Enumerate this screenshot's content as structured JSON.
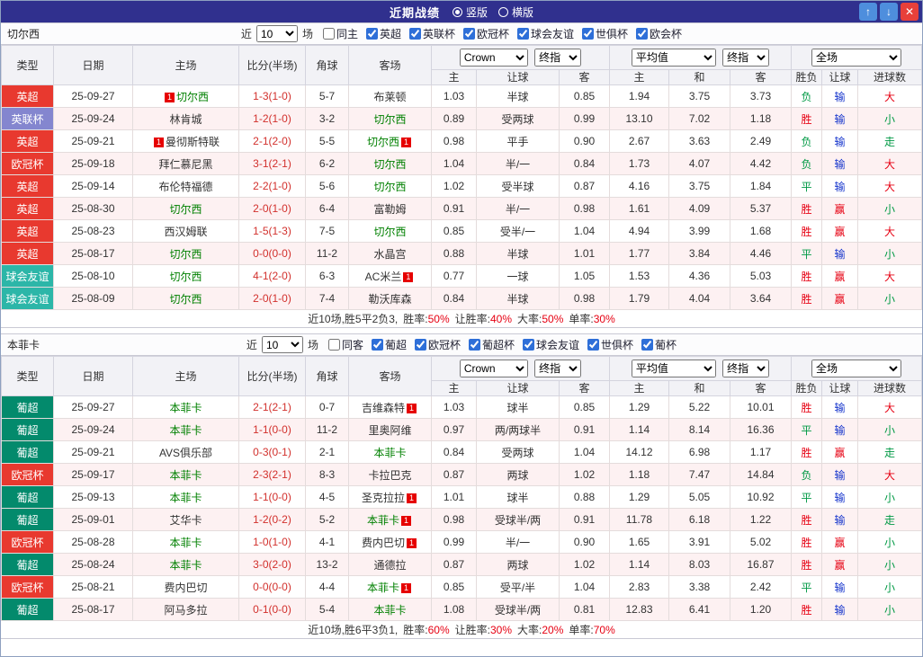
{
  "topbar": {
    "title": "近期战绩",
    "layout_options": [
      {
        "label": "竖版",
        "selected": true
      },
      {
        "label": "横版",
        "selected": false
      }
    ],
    "buttons": {
      "up": "↑",
      "down": "↓",
      "close": "✕"
    }
  },
  "badge_text": "1",
  "type_colors": {
    "英超": "#e8392f",
    "英联杯": "#8486cf",
    "欧冠杯": "#e8392f",
    "球会友谊": "#2cb6a8",
    "葡超": "#038a6c"
  },
  "result_colors": {
    "red": "#e60012",
    "green": "#009944",
    "blue": "#1534cc"
  },
  "columns": {
    "left": [
      "类型",
      "日期",
      "主场",
      "比分(半场)",
      "角球",
      "客场"
    ],
    "asian": [
      "主",
      "让球",
      "客"
    ],
    "euro": [
      "主",
      "和",
      "客"
    ],
    "result": [
      "胜负",
      "让球",
      "进球数"
    ]
  },
  "sections": [
    {
      "team": "切尔西",
      "filter": {
        "near_label": "近",
        "count": "10",
        "games_label": "场",
        "checkboxes": [
          {
            "label": "同主",
            "checked": false
          },
          {
            "label": "英超",
            "checked": true
          },
          {
            "label": "英联杯",
            "checked": true
          },
          {
            "label": "欧冠杯",
            "checked": true
          },
          {
            "label": "球会友谊",
            "checked": true
          },
          {
            "label": "世俱杯",
            "checked": true
          },
          {
            "label": "欧会杯",
            "checked": true
          }
        ]
      },
      "selects": {
        "odds_source": "Crown",
        "odds_time": "终指",
        "euro_source": "平均值",
        "euro_time": "终指",
        "scope": "全场"
      },
      "rows": [
        {
          "type": "英超",
          "date": "25-09-27",
          "home": {
            "name": "切尔西",
            "focus": true,
            "badge": "before"
          },
          "score": "1-3(1-0)",
          "corner": "5-7",
          "away": {
            "name": "布莱顿"
          },
          "asian": [
            "1.03",
            "半球",
            "0.85"
          ],
          "euro": [
            "1.94",
            "3.75",
            "3.73"
          ],
          "results": [
            [
              "负",
              "green"
            ],
            [
              "输",
              "blue"
            ],
            [
              "大",
              "red"
            ]
          ]
        },
        {
          "type": "英联杯",
          "date": "25-09-24",
          "home": {
            "name": "林肯城"
          },
          "score": "1-2(1-0)",
          "corner": "3-2",
          "away": {
            "name": "切尔西",
            "focus": true
          },
          "asian": [
            "0.89",
            "受两球",
            "0.99"
          ],
          "euro": [
            "13.10",
            "7.02",
            "1.18"
          ],
          "results": [
            [
              "胜",
              "red"
            ],
            [
              "输",
              "blue"
            ],
            [
              "小",
              "green"
            ]
          ]
        },
        {
          "type": "英超",
          "date": "25-09-21",
          "home": {
            "name": "曼彻斯特联",
            "badge": "before"
          },
          "score": "2-1(2-0)",
          "corner": "5-5",
          "away": {
            "name": "切尔西",
            "focus": true,
            "badge": "after"
          },
          "asian": [
            "0.98",
            "平手",
            "0.90"
          ],
          "euro": [
            "2.67",
            "3.63",
            "2.49"
          ],
          "results": [
            [
              "负",
              "green"
            ],
            [
              "输",
              "blue"
            ],
            [
              "走",
              "green"
            ]
          ]
        },
        {
          "type": "欧冠杯",
          "date": "25-09-18",
          "home": {
            "name": "拜仁慕尼黑"
          },
          "score": "3-1(2-1)",
          "corner": "6-2",
          "away": {
            "name": "切尔西",
            "focus": true
          },
          "asian": [
            "1.04",
            "半/一",
            "0.84"
          ],
          "euro": [
            "1.73",
            "4.07",
            "4.42"
          ],
          "results": [
            [
              "负",
              "green"
            ],
            [
              "输",
              "blue"
            ],
            [
              "大",
              "red"
            ]
          ]
        },
        {
          "type": "英超",
          "date": "25-09-14",
          "home": {
            "name": "布伦特福德"
          },
          "score": "2-2(1-0)",
          "corner": "5-6",
          "away": {
            "name": "切尔西",
            "focus": true
          },
          "asian": [
            "1.02",
            "受半球",
            "0.87"
          ],
          "euro": [
            "4.16",
            "3.75",
            "1.84"
          ],
          "results": [
            [
              "平",
              "green"
            ],
            [
              "输",
              "blue"
            ],
            [
              "大",
              "red"
            ]
          ]
        },
        {
          "type": "英超",
          "date": "25-08-30",
          "home": {
            "name": "切尔西",
            "focus": true
          },
          "score": "2-0(1-0)",
          "corner": "6-4",
          "away": {
            "name": "富勒姆"
          },
          "asian": [
            "0.91",
            "半/一",
            "0.98"
          ],
          "euro": [
            "1.61",
            "4.09",
            "5.37"
          ],
          "results": [
            [
              "胜",
              "red"
            ],
            [
              "赢",
              "red"
            ],
            [
              "小",
              "green"
            ]
          ]
        },
        {
          "type": "英超",
          "date": "25-08-23",
          "home": {
            "name": "西汉姆联"
          },
          "score": "1-5(1-3)",
          "corner": "7-5",
          "away": {
            "name": "切尔西",
            "focus": true
          },
          "asian": [
            "0.85",
            "受半/一",
            "1.04"
          ],
          "euro": [
            "4.94",
            "3.99",
            "1.68"
          ],
          "results": [
            [
              "胜",
              "red"
            ],
            [
              "赢",
              "red"
            ],
            [
              "大",
              "red"
            ]
          ]
        },
        {
          "type": "英超",
          "date": "25-08-17",
          "home": {
            "name": "切尔西",
            "focus": true
          },
          "score": "0-0(0-0)",
          "corner": "11-2",
          "away": {
            "name": "水晶宫"
          },
          "asian": [
            "0.88",
            "半球",
            "1.01"
          ],
          "euro": [
            "1.77",
            "3.84",
            "4.46"
          ],
          "results": [
            [
              "平",
              "green"
            ],
            [
              "输",
              "blue"
            ],
            [
              "小",
              "green"
            ]
          ]
        },
        {
          "type": "球会友谊",
          "date": "25-08-10",
          "home": {
            "name": "切尔西",
            "focus": true
          },
          "score": "4-1(2-0)",
          "corner": "6-3",
          "away": {
            "name": "AC米兰",
            "badge": "after"
          },
          "asian": [
            "0.77",
            "一球",
            "1.05"
          ],
          "euro": [
            "1.53",
            "4.36",
            "5.03"
          ],
          "results": [
            [
              "胜",
              "red"
            ],
            [
              "赢",
              "red"
            ],
            [
              "大",
              "red"
            ]
          ]
        },
        {
          "type": "球会友谊",
          "date": "25-08-09",
          "home": {
            "name": "切尔西",
            "focus": true
          },
          "score": "2-0(1-0)",
          "corner": "7-4",
          "away": {
            "name": "勒沃库森"
          },
          "asian": [
            "0.84",
            "半球",
            "0.98"
          ],
          "euro": [
            "1.79",
            "4.04",
            "3.64"
          ],
          "results": [
            [
              "胜",
              "red"
            ],
            [
              "赢",
              "red"
            ],
            [
              "小",
              "green"
            ]
          ]
        }
      ],
      "summary": {
        "prefix": "近10场,胜5平2负3,",
        "stats": [
          [
            "胜率:",
            "50%"
          ],
          [
            "让胜率:",
            "40%"
          ],
          [
            "大率:",
            "50%"
          ],
          [
            "单率:",
            "30%"
          ]
        ]
      }
    },
    {
      "team": "本菲卡",
      "filter": {
        "near_label": "近",
        "count": "10",
        "games_label": "场",
        "checkboxes": [
          {
            "label": "同客",
            "checked": false
          },
          {
            "label": "葡超",
            "checked": true
          },
          {
            "label": "欧冠杯",
            "checked": true
          },
          {
            "label": "葡超杯",
            "checked": true
          },
          {
            "label": "球会友谊",
            "checked": true
          },
          {
            "label": "世俱杯",
            "checked": true
          },
          {
            "label": "葡杯",
            "checked": true
          }
        ]
      },
      "selects": {
        "odds_source": "Crown",
        "odds_time": "终指",
        "euro_source": "平均值",
        "euro_time": "终指",
        "scope": "全场"
      },
      "rows": [
        {
          "type": "葡超",
          "date": "25-09-27",
          "home": {
            "name": "本菲卡",
            "focus": true
          },
          "score": "2-1(2-1)",
          "corner": "0-7",
          "away": {
            "name": "吉维森特",
            "badge": "after"
          },
          "asian": [
            "1.03",
            "球半",
            "0.85"
          ],
          "euro": [
            "1.29",
            "5.22",
            "10.01"
          ],
          "results": [
            [
              "胜",
              "red"
            ],
            [
              "输",
              "blue"
            ],
            [
              "大",
              "red"
            ]
          ]
        },
        {
          "type": "葡超",
          "date": "25-09-24",
          "home": {
            "name": "本菲卡",
            "focus": true
          },
          "score": "1-1(0-0)",
          "corner": "11-2",
          "away": {
            "name": "里奥阿维"
          },
          "asian": [
            "0.97",
            "两/两球半",
            "0.91"
          ],
          "euro": [
            "1.14",
            "8.14",
            "16.36"
          ],
          "results": [
            [
              "平",
              "green"
            ],
            [
              "输",
              "blue"
            ],
            [
              "小",
              "green"
            ]
          ]
        },
        {
          "type": "葡超",
          "date": "25-09-21",
          "home": {
            "name": "AVS俱乐部"
          },
          "score": "0-3(0-1)",
          "corner": "2-1",
          "away": {
            "name": "本菲卡",
            "focus": true
          },
          "asian": [
            "0.84",
            "受两球",
            "1.04"
          ],
          "euro": [
            "14.12",
            "6.98",
            "1.17"
          ],
          "results": [
            [
              "胜",
              "red"
            ],
            [
              "赢",
              "red"
            ],
            [
              "走",
              "green"
            ]
          ]
        },
        {
          "type": "欧冠杯",
          "date": "25-09-17",
          "home": {
            "name": "本菲卡",
            "focus": true
          },
          "score": "2-3(2-1)",
          "corner": "8-3",
          "away": {
            "name": "卡拉巴克"
          },
          "asian": [
            "0.87",
            "两球",
            "1.02"
          ],
          "euro": [
            "1.18",
            "7.47",
            "14.84"
          ],
          "results": [
            [
              "负",
              "green"
            ],
            [
              "输",
              "blue"
            ],
            [
              "大",
              "red"
            ]
          ]
        },
        {
          "type": "葡超",
          "date": "25-09-13",
          "home": {
            "name": "本菲卡",
            "focus": true
          },
          "score": "1-1(0-0)",
          "corner": "4-5",
          "away": {
            "name": "圣克拉拉",
            "badge": "after"
          },
          "asian": [
            "1.01",
            "球半",
            "0.88"
          ],
          "euro": [
            "1.29",
            "5.05",
            "10.92"
          ],
          "results": [
            [
              "平",
              "green"
            ],
            [
              "输",
              "blue"
            ],
            [
              "小",
              "green"
            ]
          ]
        },
        {
          "type": "葡超",
          "date": "25-09-01",
          "home": {
            "name": "艾华卡"
          },
          "score": "1-2(0-2)",
          "corner": "5-2",
          "away": {
            "name": "本菲卡",
            "focus": true,
            "badge": "after"
          },
          "asian": [
            "0.98",
            "受球半/两",
            "0.91"
          ],
          "euro": [
            "11.78",
            "6.18",
            "1.22"
          ],
          "results": [
            [
              "胜",
              "red"
            ],
            [
              "输",
              "blue"
            ],
            [
              "走",
              "green"
            ]
          ]
        },
        {
          "type": "欧冠杯",
          "date": "25-08-28",
          "home": {
            "name": "本菲卡",
            "focus": true
          },
          "score": "1-0(1-0)",
          "corner": "4-1",
          "away": {
            "name": "费内巴切",
            "badge": "after"
          },
          "asian": [
            "0.99",
            "半/一",
            "0.90"
          ],
          "euro": [
            "1.65",
            "3.91",
            "5.02"
          ],
          "results": [
            [
              "胜",
              "red"
            ],
            [
              "赢",
              "red"
            ],
            [
              "小",
              "green"
            ]
          ]
        },
        {
          "type": "葡超",
          "date": "25-08-24",
          "home": {
            "name": "本菲卡",
            "focus": true
          },
          "score": "3-0(2-0)",
          "corner": "13-2",
          "away": {
            "name": "通德拉"
          },
          "asian": [
            "0.87",
            "两球",
            "1.02"
          ],
          "euro": [
            "1.14",
            "8.03",
            "16.87"
          ],
          "results": [
            [
              "胜",
              "red"
            ],
            [
              "赢",
              "red"
            ],
            [
              "小",
              "green"
            ]
          ]
        },
        {
          "type": "欧冠杯",
          "date": "25-08-21",
          "home": {
            "name": "费内巴切"
          },
          "score": "0-0(0-0)",
          "corner": "4-4",
          "away": {
            "name": "本菲卡",
            "focus": true,
            "badge": "after"
          },
          "asian": [
            "0.85",
            "受平/半",
            "1.04"
          ],
          "euro": [
            "2.83",
            "3.38",
            "2.42"
          ],
          "results": [
            [
              "平",
              "green"
            ],
            [
              "输",
              "blue"
            ],
            [
              "小",
              "green"
            ]
          ]
        },
        {
          "type": "葡超",
          "date": "25-08-17",
          "home": {
            "name": "阿马多拉"
          },
          "score": "0-1(0-0)",
          "corner": "5-4",
          "away": {
            "name": "本菲卡",
            "focus": true
          },
          "asian": [
            "1.08",
            "受球半/两",
            "0.81"
          ],
          "euro": [
            "12.83",
            "6.41",
            "1.20"
          ],
          "results": [
            [
              "胜",
              "red"
            ],
            [
              "输",
              "blue"
            ],
            [
              "小",
              "green"
            ]
          ]
        }
      ],
      "summary": {
        "prefix": "近10场,胜6平3负1,",
        "stats": [
          [
            "胜率:",
            "60%"
          ],
          [
            "让胜率:",
            "30%"
          ],
          [
            "大率:",
            "20%"
          ],
          [
            "单率:",
            "70%"
          ]
        ]
      }
    }
  ]
}
